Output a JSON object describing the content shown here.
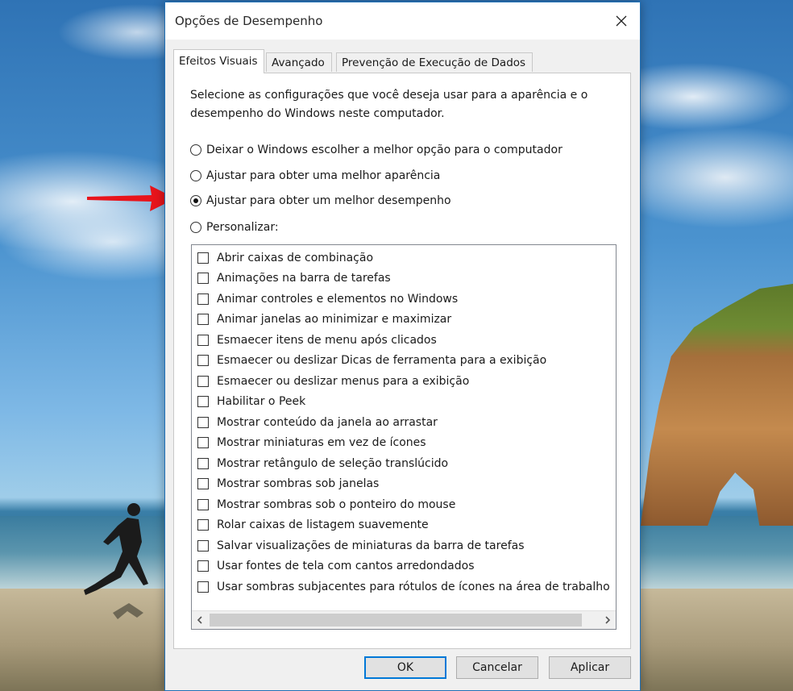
{
  "dialog": {
    "title": "Opções de Desempenho",
    "tabs": [
      {
        "label": "Efeitos Visuais",
        "active": true
      },
      {
        "label": "Avançado",
        "active": false
      },
      {
        "label": "Prevenção de Execução de Dados",
        "active": false
      }
    ],
    "description": "Selecione as configurações que você deseja usar para a aparência e o desempenho do Windows neste computador.",
    "radios": [
      {
        "label": "Deixar o Windows escolher a melhor opção para o computador",
        "checked": false
      },
      {
        "label": "Ajustar para obter uma melhor aparência",
        "checked": false
      },
      {
        "label": "Ajustar para obter um melhor desempenho",
        "checked": true
      },
      {
        "label": "Personalizar:",
        "checked": false
      }
    ],
    "checkboxes": [
      {
        "label": "Abrir caixas de combinação",
        "checked": false
      },
      {
        "label": "Animações na barra de tarefas",
        "checked": false
      },
      {
        "label": "Animar controles e elementos no Windows",
        "checked": false
      },
      {
        "label": "Animar janelas ao minimizar e maximizar",
        "checked": false
      },
      {
        "label": "Esmaecer itens de menu após clicados",
        "checked": false
      },
      {
        "label": "Esmaecer ou deslizar Dicas de ferramenta para a exibição",
        "checked": false
      },
      {
        "label": "Esmaecer ou deslizar menus para a exibição",
        "checked": false
      },
      {
        "label": "Habilitar o Peek",
        "checked": false
      },
      {
        "label": "Mostrar conteúdo da janela ao arrastar",
        "checked": false
      },
      {
        "label": "Mostrar miniaturas em vez de ícones",
        "checked": false
      },
      {
        "label": "Mostrar retângulo de seleção translúcido",
        "checked": false
      },
      {
        "label": "Mostrar sombras sob janelas",
        "checked": false
      },
      {
        "label": "Mostrar sombras sob o ponteiro do mouse",
        "checked": false
      },
      {
        "label": "Rolar caixas de listagem suavemente",
        "checked": false
      },
      {
        "label": "Salvar visualizações de miniaturas da barra de tarefas",
        "checked": false
      },
      {
        "label": "Usar fontes de tela com cantos arredondados",
        "checked": false
      },
      {
        "label": "Usar sombras subjacentes para rótulos de ícones na área de trabalho",
        "checked": false
      }
    ],
    "scroll_left_icon": "chevron-left-icon",
    "scroll_right_icon": "chevron-right-icon",
    "buttons": {
      "ok": "OK",
      "cancel": "Cancelar",
      "apply": "Aplicar"
    }
  },
  "colors": {
    "accent": "#0078d7",
    "annotation_arrow": "#e8141b",
    "dialog_border": "#1f6fb5"
  }
}
